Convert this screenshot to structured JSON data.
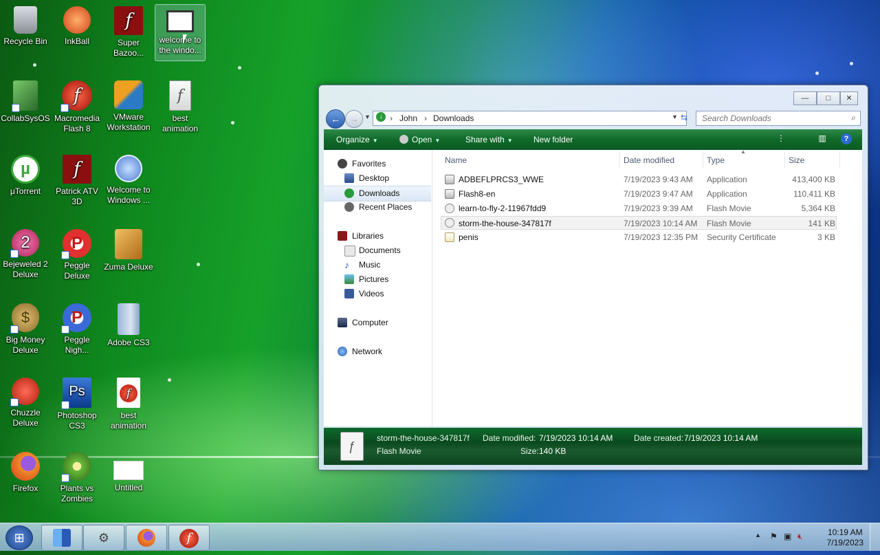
{
  "desktop": {
    "icons": [
      {
        "label": "Recycle Bin",
        "icon": "recycle-bin-icon",
        "color": "#7a7a7a"
      },
      {
        "label": "InkBall",
        "icon": "inkball-icon",
        "color": "#e05a1a"
      },
      {
        "label": "Super Bazoo...",
        "icon": "flash-icon",
        "color": "#9a1a1a"
      },
      {
        "label": "welcome to the windo...",
        "icon": "video-file-icon",
        "color": "#ffffff"
      },
      {
        "label": "CollabSysOS",
        "icon": "collabsys-icon",
        "color": "#4a8a3a"
      },
      {
        "label": "Macromedia Flash 8",
        "icon": "macromedia-flash-icon",
        "color": "#d62a1a"
      },
      {
        "label": "VMware Workstation",
        "icon": "vmware-icon",
        "color": "#2a7ac8"
      },
      {
        "label": "best animation",
        "icon": "flash-movie-file-icon",
        "color": "#e8e8e8"
      },
      {
        "label": "μTorrent",
        "icon": "utorrent-icon",
        "color": "#3aa83a"
      },
      {
        "label": "Patrick ATV 3D",
        "icon": "flash-icon",
        "color": "#9a1a1a"
      },
      {
        "label": "Welcome to Windows ...",
        "icon": "windows-orb-icon",
        "color": "#4a7ad0"
      },
      {
        "label": "Bejeweled 2 Deluxe",
        "icon": "bejeweled-icon",
        "color": "#c82a6a"
      },
      {
        "label": "Peggle Deluxe",
        "icon": "peggle-icon",
        "color": "#d83a3a"
      },
      {
        "label": "Zuma Deluxe",
        "icon": "zuma-icon",
        "color": "#d8902a"
      },
      {
        "label": "Big Money Deluxe",
        "icon": "money-bag-icon",
        "color": "#b8903a"
      },
      {
        "label": "Peggle Nigh...",
        "icon": "peggle-nights-icon",
        "color": "#3a6ad8"
      },
      {
        "label": "Adobe CS3",
        "icon": "folder-icon",
        "color": "#7a9ac8"
      },
      {
        "label": "Chuzzle Deluxe",
        "icon": "chuzzle-icon",
        "color": "#e03a2a"
      },
      {
        "label": "Photoshop CS3",
        "icon": "photoshop-icon",
        "color": "#1a5ab8"
      },
      {
        "label": "best animation",
        "icon": "flash-document-icon",
        "color": "#d82a2a"
      },
      {
        "label": "Firefox",
        "icon": "firefox-icon",
        "color": "#e8702a"
      },
      {
        "label": "Plants vs Zombies",
        "icon": "plants-vs-zombies-icon",
        "color": "#5aa83a"
      },
      {
        "label": "Untitled",
        "icon": "blank-document-icon",
        "color": "#ffffff"
      }
    ]
  },
  "explorer": {
    "breadcrumb": [
      "John",
      "Downloads"
    ],
    "search_placeholder": "Search Downloads",
    "toolbar": {
      "organize": "Organize",
      "open": "Open",
      "share_with": "Share with",
      "new_folder": "New folder"
    },
    "nav": {
      "favorites": "Favorites",
      "desktop": "Desktop",
      "downloads": "Downloads",
      "recent_places": "Recent Places",
      "libraries": "Libraries",
      "documents": "Documents",
      "music": "Music",
      "pictures": "Pictures",
      "videos": "Videos",
      "computer": "Computer",
      "network": "Network"
    },
    "columns": {
      "name": "Name",
      "date_modified": "Date modified",
      "type": "Type",
      "size": "Size"
    },
    "files": [
      {
        "name": "ADBEFLPRCS3_WWE",
        "date": "7/19/2023 9:43 AM",
        "type": "Application",
        "size": "413,400 KB",
        "icon": "installer-icon"
      },
      {
        "name": "Flash8-en",
        "date": "7/19/2023 9:47 AM",
        "type": "Application",
        "size": "110,411 KB",
        "icon": "installer-icon"
      },
      {
        "name": "learn-to-fly-2-11967fdd9",
        "date": "7/19/2023 9:39 AM",
        "type": "Flash Movie",
        "size": "5,364 KB",
        "icon": "flash-movie-icon"
      },
      {
        "name": "storm-the-house-347817f",
        "date": "7/19/2023 10:14 AM",
        "type": "Flash Movie",
        "size": "141 KB",
        "icon": "flash-movie-icon"
      },
      {
        "name": "penis",
        "date": "7/19/2023 12:35 PM",
        "type": "Security Certificate",
        "size": "3 KB",
        "icon": "certificate-icon"
      }
    ],
    "details": {
      "name": "storm-the-house-347817f",
      "type": "Flash Movie",
      "date_modified_label": "Date modified:",
      "date_modified": "7/19/2023 10:14 AM",
      "date_created_label": "Date created:",
      "date_created": "7/19/2023 10:14 AM",
      "size_label": "Size:",
      "size": "140 KB"
    }
  },
  "taskbar": {
    "time": "10:19 AM",
    "date": "7/19/2023"
  }
}
